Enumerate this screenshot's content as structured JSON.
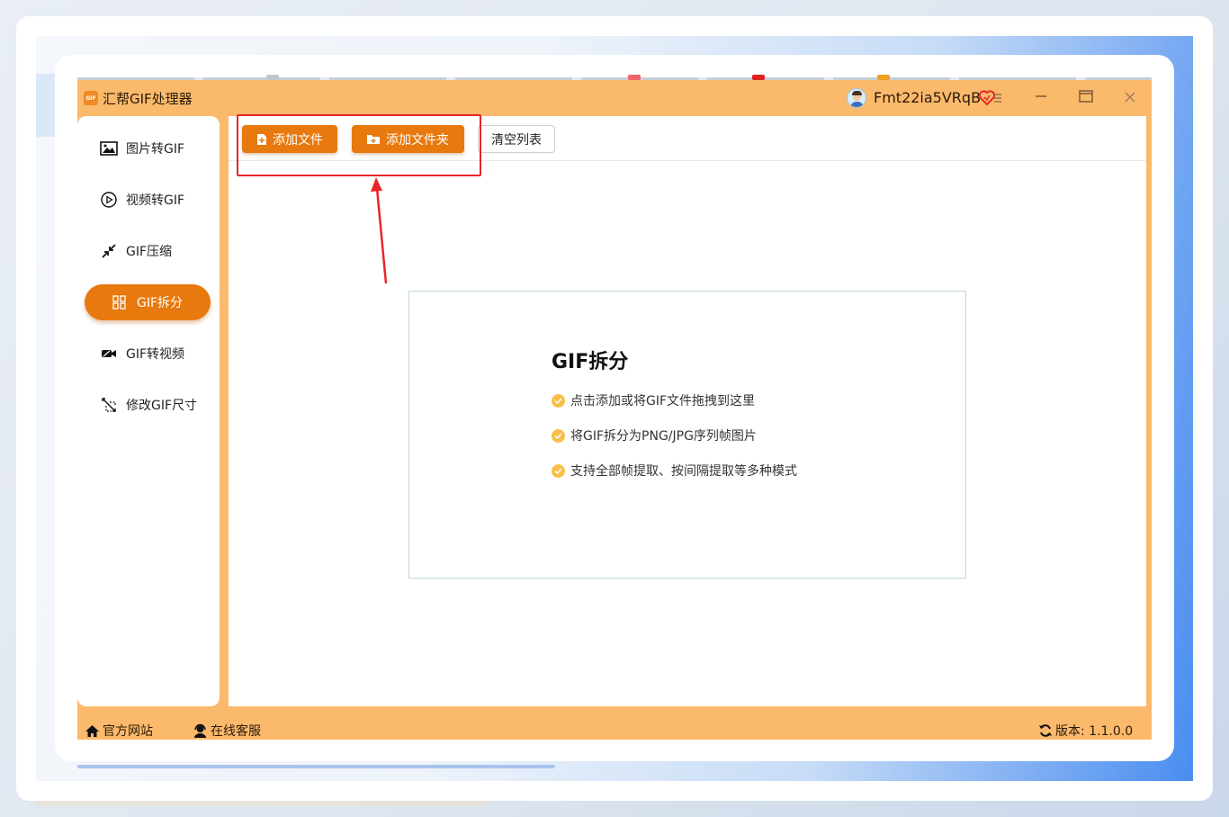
{
  "app": {
    "title": "汇帮GIF处理器",
    "logo_text": "GIF",
    "username": "Fmt22ia5VRqB"
  },
  "sidebar": {
    "items": [
      {
        "label": "图片转GIF",
        "icon": "image-icon"
      },
      {
        "label": "视频转GIF",
        "icon": "play-icon"
      },
      {
        "label": "GIF压缩",
        "icon": "compress-icon"
      },
      {
        "label": "GIF拆分",
        "icon": "split-grid-icon",
        "active": true
      },
      {
        "label": "GIF转视频",
        "icon": "video-camera-icon"
      },
      {
        "label": "修改GIF尺寸",
        "icon": "resize-icon"
      }
    ]
  },
  "toolbar": {
    "add_file": "添加文件",
    "add_folder": "添加文件夹",
    "clear_list": "清空列表"
  },
  "dropzone": {
    "title": "GIF拆分",
    "tips": [
      "点击添加或将GIF文件拖拽到这里",
      "将GIF拆分为PNG/JPG序列帧图片",
      "支持全部帧提取、按间隔提取等多种模式"
    ]
  },
  "footer": {
    "website": "官方网站",
    "support": "在线客服",
    "version": "版本: 1.1.0.0"
  },
  "colors": {
    "accent": "#e8790e",
    "frame": "#fbb96b",
    "annotation": "#e8262a"
  }
}
